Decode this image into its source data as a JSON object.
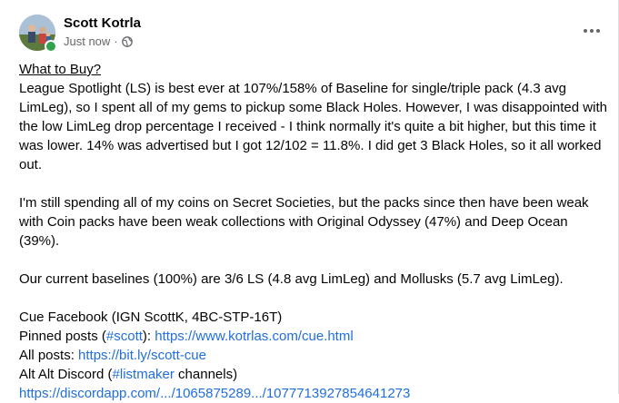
{
  "post": {
    "author": "Scott Kotrla",
    "timestamp": "Just now",
    "separator": "·",
    "heading": "What to Buy?",
    "paragraph1": "League Spotlight (LS) is best ever at 107%/158% of Baseline for single/triple pack (4.3 avg LimLeg), so I spent all of my gems to pickup some Black Holes. However, I was disappointed with the low LimLeg drop percentage I received - I think normally it's quite a bit higher, but this time it was lower. 14% was advertised but I got 12/102 = 11.8%. I did get 3 Black Holes, so it all worked out.",
    "paragraph2": "I'm still spending all of my coins on Secret Societies, but the packs since then have been weak with Coin packs have been weak collections with Original Odyssey (47%) and Deep Ocean (39%).",
    "paragraph3": "Our current baselines (100%) are 3/6 LS (4.8 avg LimLeg) and Mollusks (5.7 avg LimLeg).",
    "footer": {
      "line1": "Cue Facebook (IGN ScottK, 4BC-STP-16T)",
      "pinned_prefix": "Pinned posts (",
      "pinned_tag": "#scott",
      "pinned_mid": "): ",
      "pinned_url": "https://www.kotrlas.com/cue.html",
      "allposts_prefix": "All posts: ",
      "allposts_url": "https://bit.ly/scott-cue",
      "discord_prefix": "Alt Alt Discord (",
      "discord_tag": "#listmaker",
      "discord_suffix": " channels)",
      "discord_url": "https://discordapp.com/.../1065875289.../1077713927854641273"
    }
  },
  "icons": {
    "globe": "globe-icon",
    "more": "more-options-icon"
  },
  "colors": {
    "link": "#216fdb",
    "meta": "#65676b",
    "online": "#31a24c"
  }
}
